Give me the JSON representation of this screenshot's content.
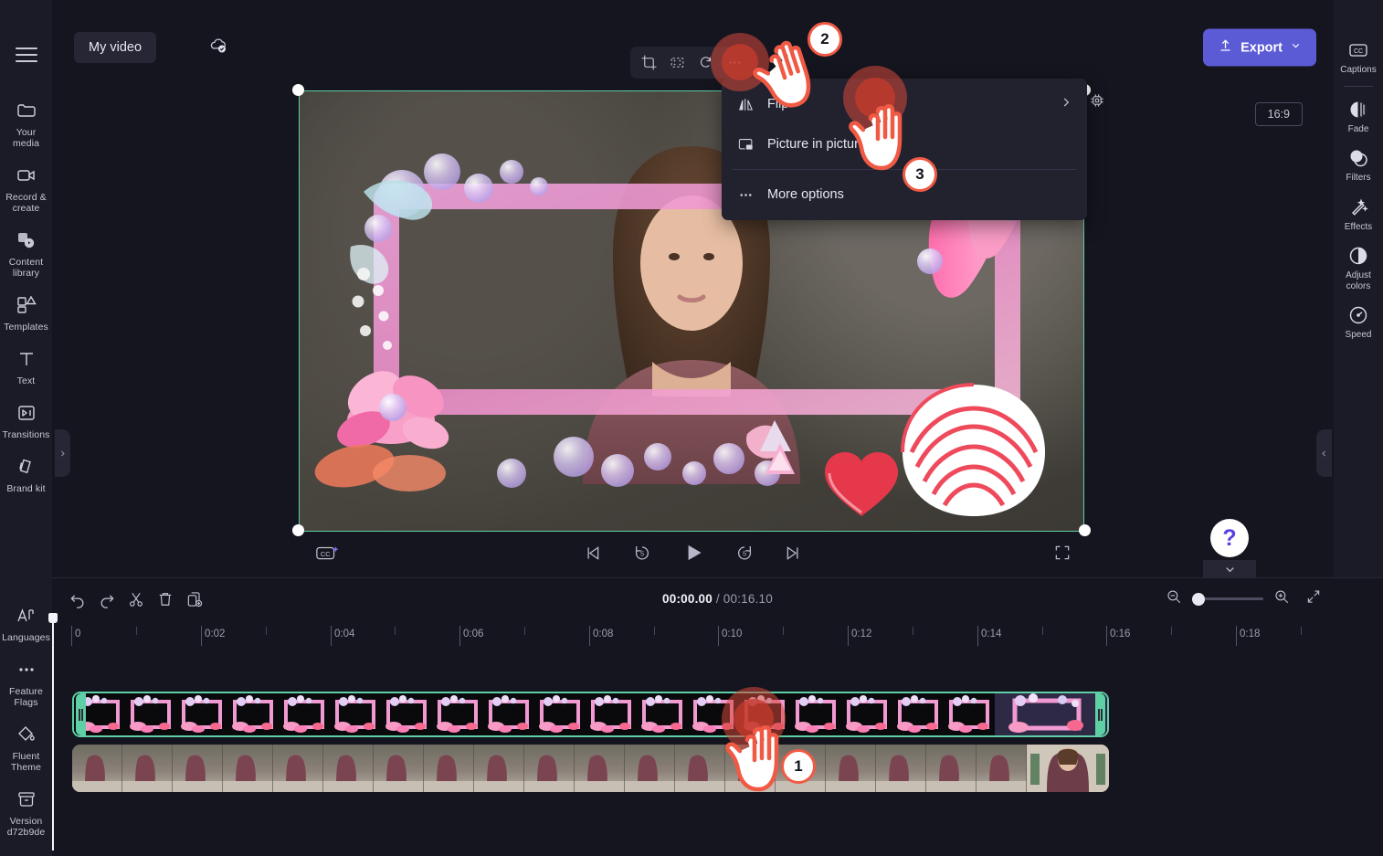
{
  "app": {
    "project_title": "My video",
    "export_label": "Export",
    "aspect_ratio": "16:9"
  },
  "sidebar_left": {
    "menu_icon": "hamburger-icon",
    "items": [
      {
        "label": "Your media",
        "icon": "folder-icon"
      },
      {
        "label": "Record & create",
        "icon": "video-camera-icon"
      },
      {
        "label": "Content library",
        "icon": "content-library-icon"
      },
      {
        "label": "Templates",
        "icon": "templates-icon"
      },
      {
        "label": "Text",
        "icon": "text-icon"
      },
      {
        "label": "Transitions",
        "icon": "transitions-icon"
      },
      {
        "label": "Brand kit",
        "icon": "brand-kit-icon"
      }
    ],
    "bottom_items": [
      {
        "label": "Languages",
        "icon": "languages-icon"
      },
      {
        "label": "Feature Flags",
        "icon": "ellipsis-icon"
      },
      {
        "label": "Fluent Theme",
        "icon": "paint-bucket-icon"
      },
      {
        "label": "Version d72b9de",
        "icon": "archive-icon"
      }
    ]
  },
  "sidebar_right": {
    "items": [
      {
        "label": "Captions",
        "icon": "cc-icon"
      },
      {
        "label": "Fade",
        "icon": "fade-icon"
      },
      {
        "label": "Filters",
        "icon": "filters-icon"
      },
      {
        "label": "Effects",
        "icon": "effects-wand-icon"
      },
      {
        "label": "Adjust colors",
        "icon": "adjust-colors-icon"
      },
      {
        "label": "Speed",
        "icon": "speedometer-icon"
      }
    ]
  },
  "clip_toolbar": {
    "buttons": [
      {
        "name": "crop-icon"
      },
      {
        "name": "fit-to-frame-icon"
      },
      {
        "name": "rotate-icon"
      },
      {
        "name": "more-ellipsis-icon"
      }
    ]
  },
  "context_menu": {
    "items": [
      {
        "label": "Flip",
        "icon": "flip-icon",
        "has_submenu": true
      },
      {
        "label": "Picture in picture",
        "icon": "picture-in-picture-icon",
        "has_submenu": false
      },
      {
        "label": "More options",
        "icon": "ellipsis-icon",
        "has_submenu": false
      }
    ]
  },
  "player": {
    "cc_button": "cc-sparkle-icon",
    "controls": [
      {
        "name": "skip-to-start-button"
      },
      {
        "name": "rewind-5-button",
        "label": "5"
      },
      {
        "name": "play-button"
      },
      {
        "name": "forward-5-button",
        "label": "5"
      },
      {
        "name": "skip-to-end-button"
      }
    ],
    "fullscreen": "fullscreen-icon",
    "help_label": "?"
  },
  "timeline": {
    "tools": [
      {
        "name": "undo-icon"
      },
      {
        "name": "redo-icon"
      },
      {
        "name": "split-scissors-icon"
      },
      {
        "name": "delete-trash-icon"
      },
      {
        "name": "duplicate-icon"
      }
    ],
    "current_time": "00:00.00",
    "separator": "/",
    "total_time": "00:16.10",
    "zoom_out_icon": "zoom-out-icon",
    "zoom_in_icon": "zoom-in-icon",
    "collapse_icon": "collapse-diagonal-icon",
    "ruler_labels": [
      "0",
      "0:02",
      "0:04",
      "0:06",
      "0:08",
      "0:10",
      "0:12",
      "0:14",
      "0:16",
      "0:18"
    ],
    "tracks": [
      {
        "name": "overlay-frame-clip",
        "selected": true
      },
      {
        "name": "video-clip",
        "selected": false
      }
    ]
  },
  "annotations": [
    {
      "number": "1",
      "target": "timeline-clip"
    },
    {
      "number": "2",
      "target": "more-options-toolbar-button"
    },
    {
      "number": "3",
      "target": "flip-submenu-arrow"
    }
  ],
  "colors": {
    "accent": "#5b5bd6",
    "selection": "#5fcfa5",
    "annotation": "#f05a44",
    "panel": "#1b1b27",
    "background": "#15151f"
  }
}
